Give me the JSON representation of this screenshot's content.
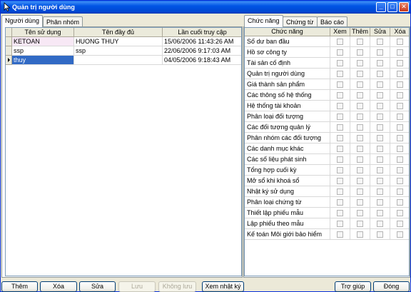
{
  "window": {
    "title": "Quản trị người dùng",
    "controls": {
      "minimize": "_",
      "maximize": "□",
      "close": "✕"
    }
  },
  "left_tabs": [
    "Người dùng",
    "Phân nhóm"
  ],
  "users": {
    "columns": [
      "Tên sử dụng",
      "Tên đầy đủ",
      "Lần cuối truy cập"
    ],
    "rows": [
      {
        "username": "KETOAN",
        "fullname": "HUONG THUY",
        "last_access": "15/06/2006 11:43:26 AM"
      },
      {
        "username": "ssp",
        "fullname": "ssp",
        "last_access": "22/06/2006 9:17:03 AM"
      },
      {
        "username": "thuy",
        "fullname": "",
        "last_access": "04/05/2006 9:18:43 AM"
      }
    ]
  },
  "right_tabs": [
    "Chức năng",
    "Chứng từ",
    "Báo cáo"
  ],
  "functions": {
    "columns": [
      "Chức năng",
      "Xem",
      "Thêm",
      "Sửa",
      "Xóa"
    ],
    "rows": [
      "Số dư ban đầu",
      "Hồ sơ công ty",
      "Tài sản cố định",
      "Quản trị người dùng",
      "Giá thành sản phẩm",
      "Các thông số hệ thống",
      "Hệ thống tài khoản",
      "Phân loại đối tượng",
      "Các đối tượng quản lý",
      "Phân nhóm các đối tượng",
      "Các danh mục khác",
      "Các số liệu phát sinh",
      "Tổng hợp cuối kỳ",
      "Mở sổ khi khoá sổ",
      "Nhật ký sử dụng",
      "Phân loại chứng từ",
      "Thiết lập phiếu mẫu",
      "Lập phiếu theo mẫu",
      "Kế toán Môi giới bảo hiểm"
    ]
  },
  "buttons": {
    "add": "Thêm",
    "delete": "Xóa",
    "edit": "Sửa",
    "save": "Lưu",
    "dont_save": "Không lưu",
    "view_log": "Xem nhật ký",
    "help": "Trợ giúp",
    "close": "Đóng"
  },
  "colors": {
    "titlebar": "#0055e5",
    "selection": "#316ac5",
    "window_bg": "#ece9d8"
  }
}
